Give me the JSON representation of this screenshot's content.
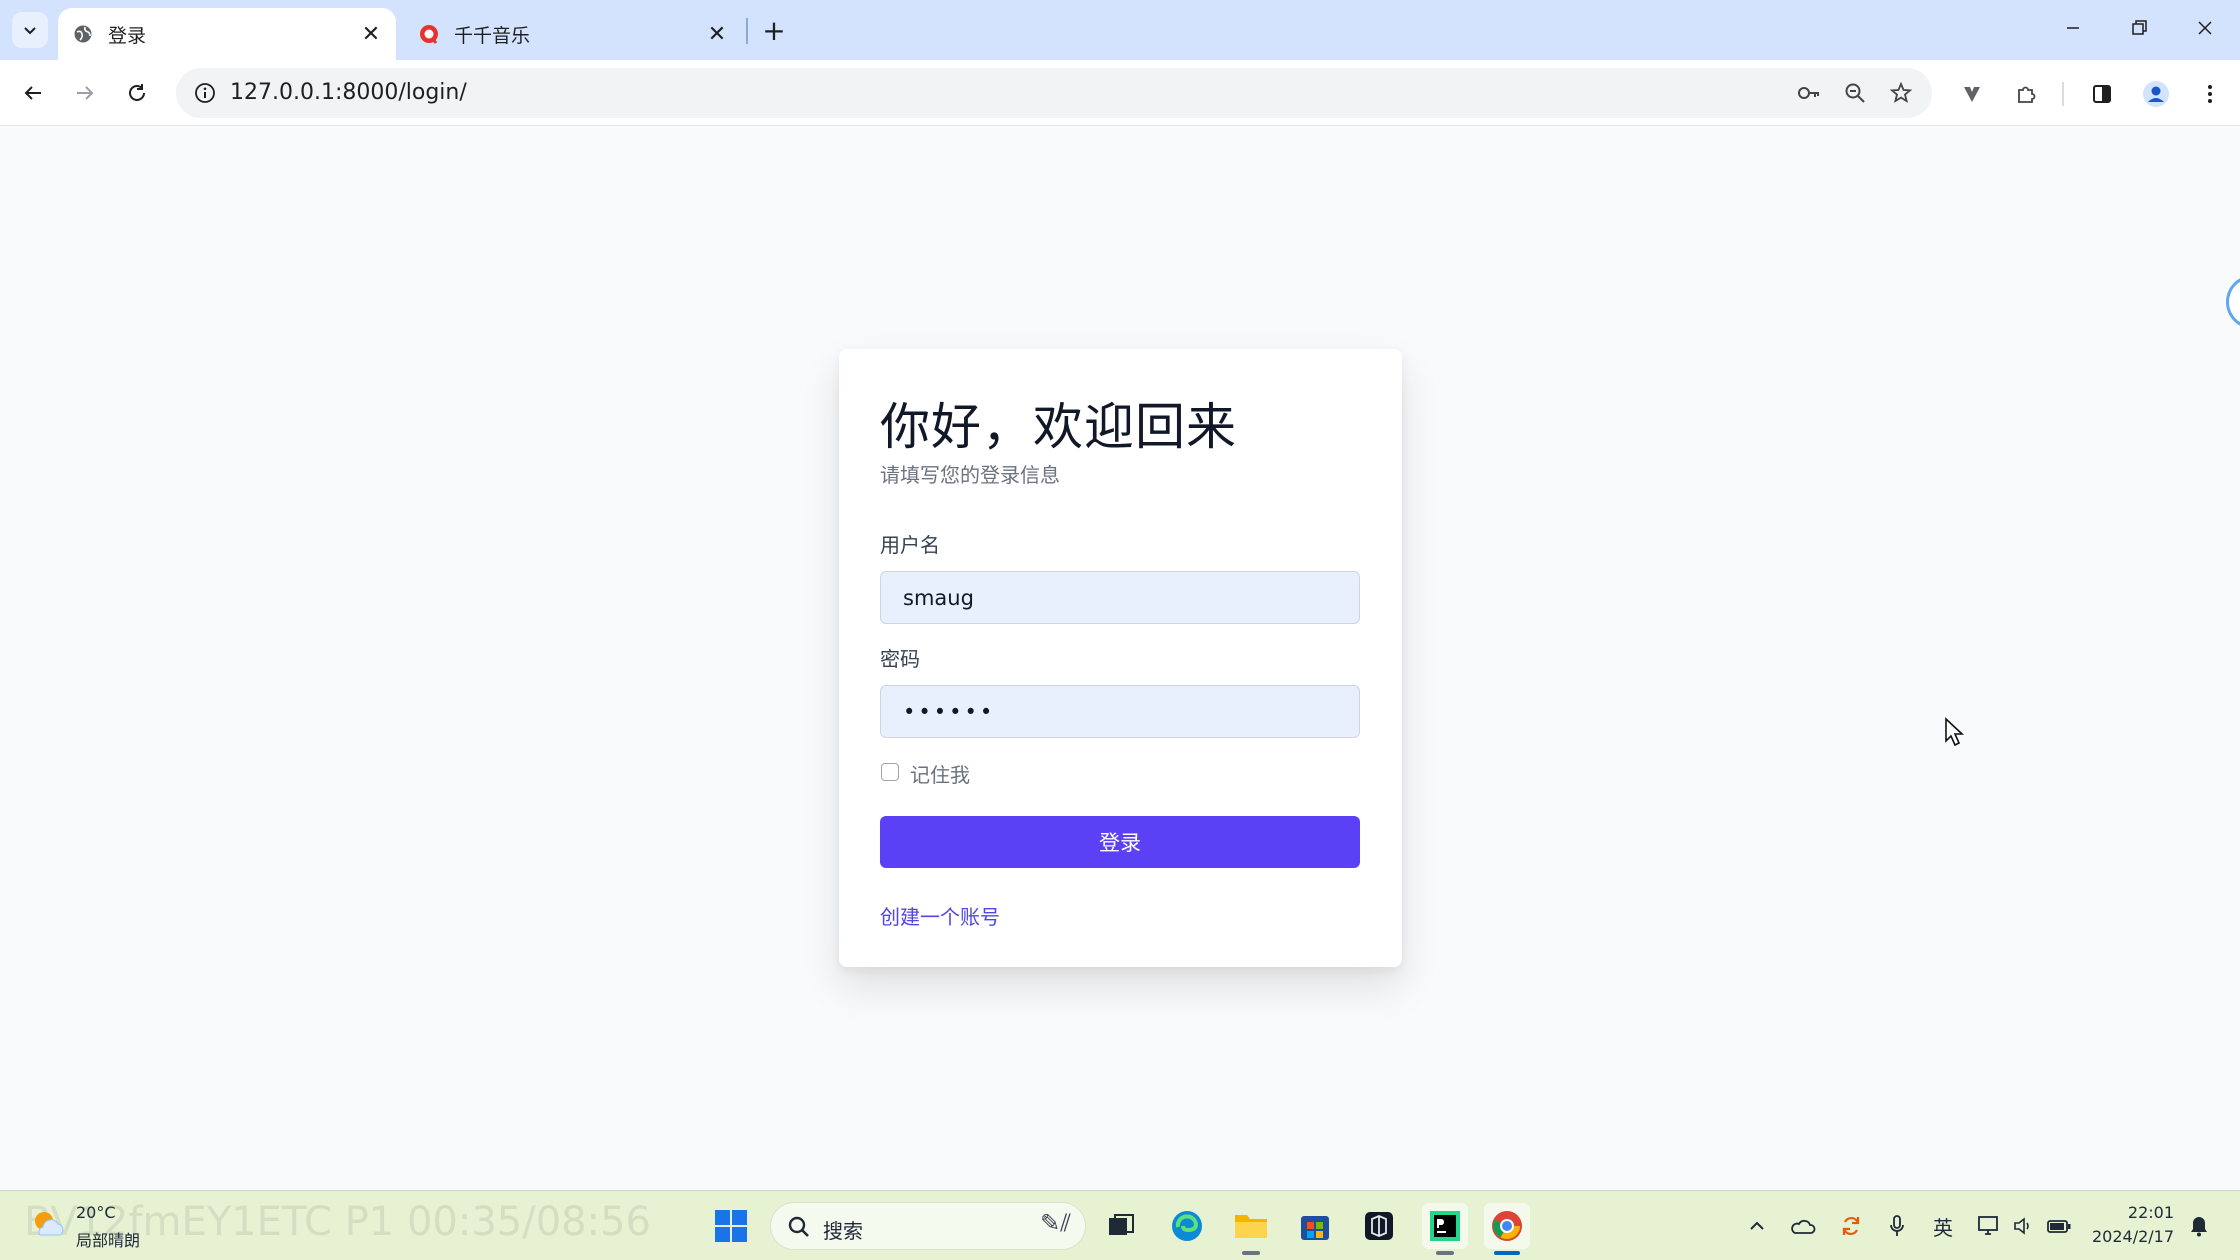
{
  "browser": {
    "tabs": [
      {
        "title": "登录",
        "favicon": "globe-icon",
        "active": true
      },
      {
        "title": "千千音乐",
        "favicon": "qianqian-music-icon",
        "active": false
      }
    ],
    "new_tab_label": "+",
    "url": "127.0.0.1:8000/login/"
  },
  "login": {
    "heading": "你好，欢迎回来",
    "subtitle": "请填写您的登录信息",
    "username_label": "用户名",
    "username_value": "smaug",
    "password_label": "密码",
    "password_value": "••••••",
    "remember_label": "记住我",
    "remember_checked": false,
    "submit_label": "登录",
    "create_account_link": "创建一个账号",
    "accent_color": "#5b41f5",
    "link_color": "#4f46e5"
  },
  "taskbar": {
    "weather_temp": "20°C",
    "weather_desc": "局部晴朗",
    "watermark": "BV12fmEY1ETC P1 00:35/08:56",
    "search_label": "搜索",
    "ime_label": "英",
    "time": "22:01",
    "date": "2024/2/17"
  }
}
